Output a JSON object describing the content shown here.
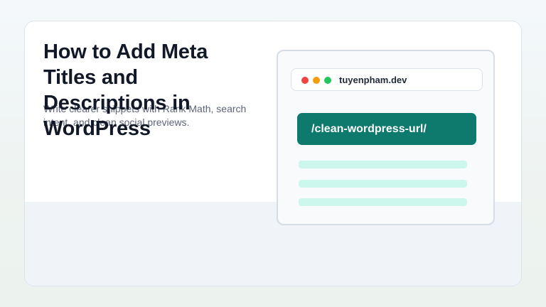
{
  "article": {
    "title": "How to Add Meta Titles and Descriptions in WordPress",
    "subtitle": "Write clearer snippets with Rank Math, search intent, and clean social previews."
  },
  "browser_mock": {
    "domain": "tuyenpham.dev",
    "url_slug": "/clean-wordpress-url/",
    "window_dots": [
      "red-dot",
      "amber-dot",
      "green-dot"
    ],
    "colors": {
      "slug_background": "#0e7a6e",
      "placeholder_lines": "#ccf7ec",
      "dot_red": "#ef4444",
      "dot_amber": "#f59e0b",
      "dot_green": "#22c55e"
    },
    "placeholder_line_count": 3
  }
}
